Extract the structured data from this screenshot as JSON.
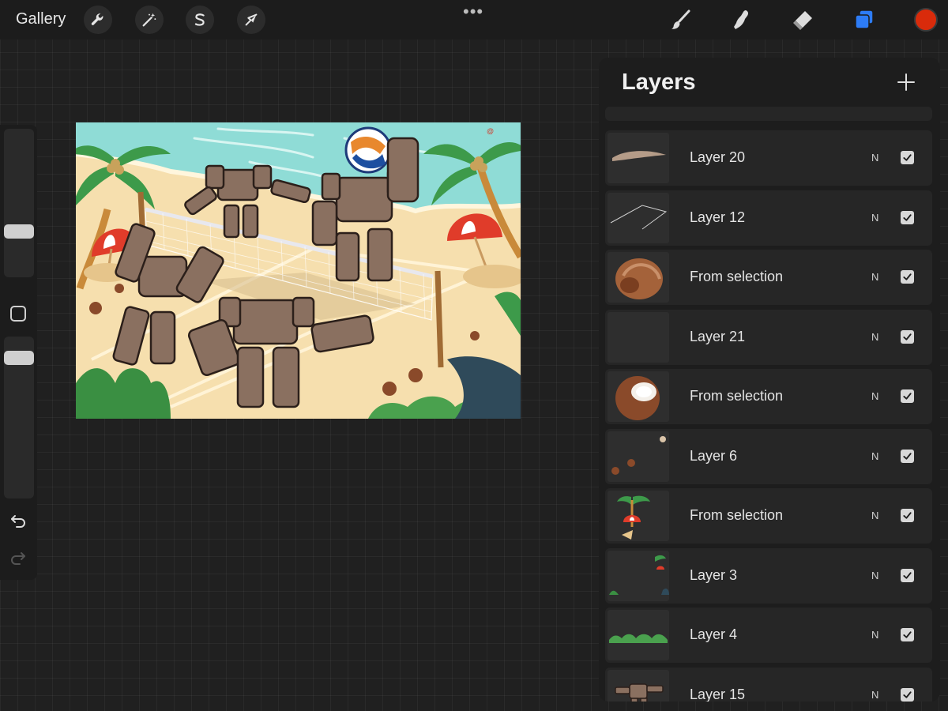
{
  "topbar": {
    "gallery_label": "Gallery",
    "left_tools": [
      {
        "icon": "wrench-icon",
        "name": "actions"
      },
      {
        "icon": "magic-wand-icon",
        "name": "adjustments"
      },
      {
        "icon": "selection-s-icon",
        "name": "selection"
      },
      {
        "icon": "arrow-cursor-icon",
        "name": "transform"
      }
    ],
    "more_label": "•••",
    "right_tools": [
      {
        "icon": "brush-icon",
        "name": "paint"
      },
      {
        "icon": "smudge-icon",
        "name": "smudge"
      },
      {
        "icon": "eraser-icon",
        "name": "erase"
      },
      {
        "icon": "layers-icon",
        "name": "layers"
      }
    ],
    "active_color": "#d92b0b"
  },
  "canvas": {
    "signature": "@"
  },
  "layers_panel": {
    "title": "Layers",
    "add_icon": "plus-icon",
    "layers": [
      {
        "name": "Layer 20",
        "blend": "N",
        "visible": true,
        "thumb": "stroke"
      },
      {
        "name": "Layer 12",
        "blend": "N",
        "visible": true,
        "thumb": "lines"
      },
      {
        "name": "From selection",
        "blend": "N",
        "visible": true,
        "thumb": "coconut-half"
      },
      {
        "name": "Layer 21",
        "blend": "N",
        "visible": true,
        "thumb": "empty"
      },
      {
        "name": "From selection",
        "blend": "N",
        "visible": true,
        "thumb": "coconut-open"
      },
      {
        "name": "Layer 6",
        "blend": "N",
        "visible": true,
        "thumb": "coconut-pieces"
      },
      {
        "name": "From selection",
        "blend": "N",
        "visible": true,
        "thumb": "palm-umbrella"
      },
      {
        "name": "Layer 3",
        "blend": "N",
        "visible": true,
        "thumb": "plants"
      },
      {
        "name": "Layer 4",
        "blend": "N",
        "visible": true,
        "thumb": "bushes"
      },
      {
        "name": "Layer 15",
        "blend": "N",
        "visible": true,
        "thumb": "robot"
      }
    ]
  },
  "colors": {
    "accent_blue": "#2d7cf6",
    "panel_bg": "#1d1d1d",
    "canvas_bg": "#202020"
  }
}
